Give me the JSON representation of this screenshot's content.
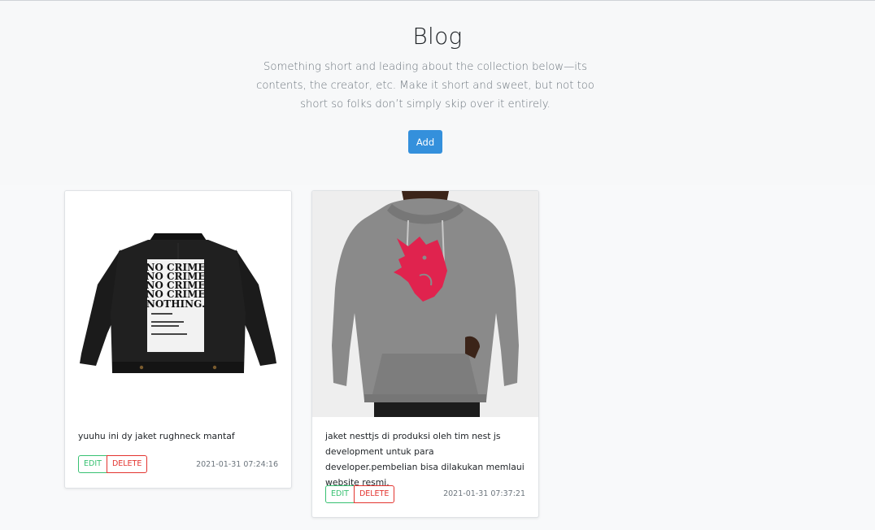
{
  "hero": {
    "title": "Blog",
    "lead": "Something short and leading about the collection below—its contents, the creator, etc. Make it short and sweet, but not too short so folks don’t simply skip over it entirely.",
    "add_label": "Add"
  },
  "cards": [
    {
      "image_icon": "black-denim-jacket-image",
      "print_lines": [
        "NO CRIME",
        "NO CRIME",
        "NO CRIME",
        "NO CRIME",
        "NOTHING."
      ],
      "text": "yuuhu ini dy jaket rughneck mantaf",
      "edit_label": "EDIT",
      "delete_label": "DELETE",
      "date": "2021-01-31 07:24:16"
    },
    {
      "image_icon": "grey-hoodie-image",
      "text": "jaket nesttjs di produksi oleh tim nest js development untuk para developer.pembelian bisa dilakukan memlaui website resmi.",
      "edit_label": "EDIT",
      "delete_label": "DELETE",
      "date": "2021-01-31 07:37:21"
    }
  ],
  "colors": {
    "primary": "#3490dc",
    "success": "#38c172",
    "danger": "#e3342f",
    "muted": "#6c757d"
  }
}
